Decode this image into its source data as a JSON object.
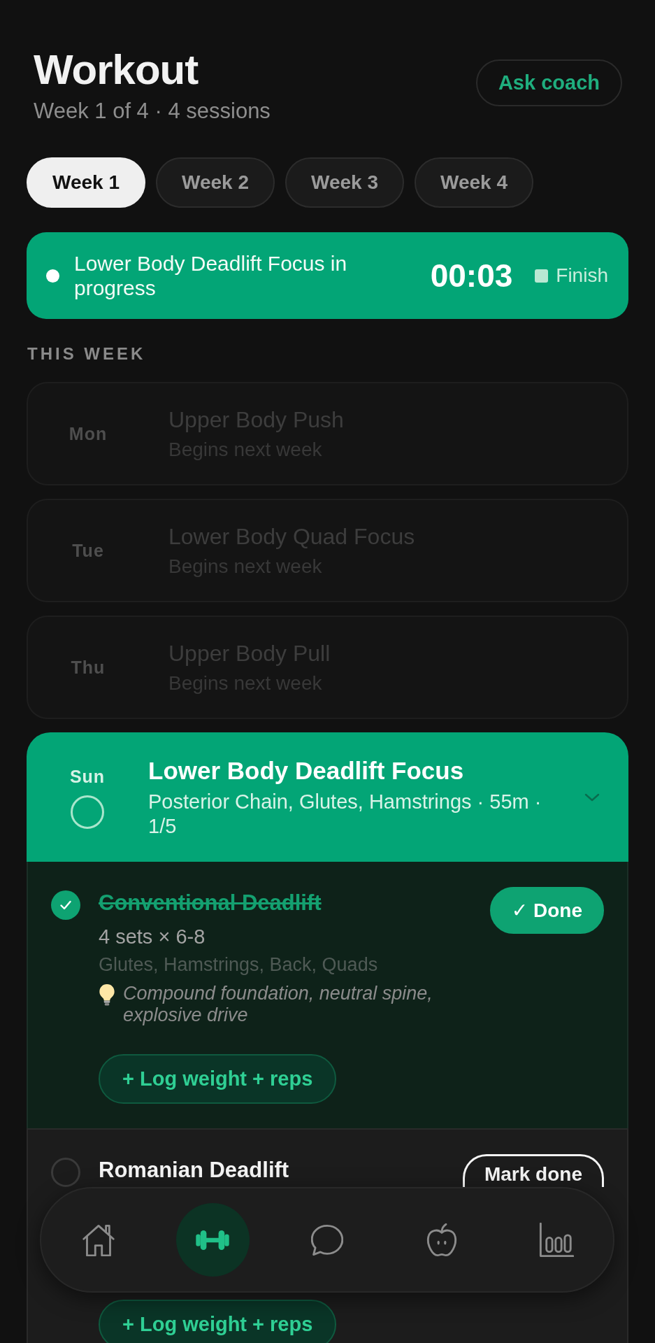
{
  "header": {
    "title": "Workout",
    "subtitle": "Week 1 of 4 · 4 sessions",
    "coach_button": "Ask coach"
  },
  "week_tabs": [
    {
      "label": "Week 1",
      "selected": true
    },
    {
      "label": "Week 2",
      "selected": false
    },
    {
      "label": "Week 3",
      "selected": false
    },
    {
      "label": "Week 4",
      "selected": false
    }
  ],
  "active_session_banner": {
    "text": "Lower Body Deadlift Focus in progress",
    "timer": "00:03",
    "finish_button": "Finish"
  },
  "section_label": "THIS WEEK",
  "sessions": [
    {
      "kind": "upcoming",
      "day": "Mon",
      "title": "Upper Body Push",
      "note": "Begins next week"
    },
    {
      "kind": "upcoming",
      "day": "Tue",
      "title": "Lower Body Quad Focus",
      "note": "Begins next week"
    },
    {
      "kind": "upcoming",
      "day": "Thu",
      "title": "Upper Body Pull",
      "note": "Begins next week"
    },
    {
      "kind": "active",
      "day": "Sun",
      "title": "Lower Body Deadlift Focus",
      "details": "Posterior Chain, Glutes, Hamstrings · 55m · 1/5",
      "completed": false,
      "expanded": true,
      "exercises": [
        {
          "name": "Conventional Deadlift",
          "completed": true,
          "status_button": "✓ Done",
          "sets": "4 sets × 6-8",
          "muscles": "Glutes, Hamstrings, Back, Quads",
          "tip": "Compound foundation, neutral spine, explosive drive",
          "log_button": "+ Log weight + reps"
        },
        {
          "name": "Romanian Deadlift",
          "completed": false,
          "status_button": "Mark done",
          "log_button": "+ Log weight + reps"
        }
      ]
    }
  ],
  "bottom_nav": {
    "items": [
      {
        "selected": false
      },
      {
        "selected": true
      },
      {
        "selected": false
      },
      {
        "selected": false
      },
      {
        "selected": false
      }
    ]
  }
}
